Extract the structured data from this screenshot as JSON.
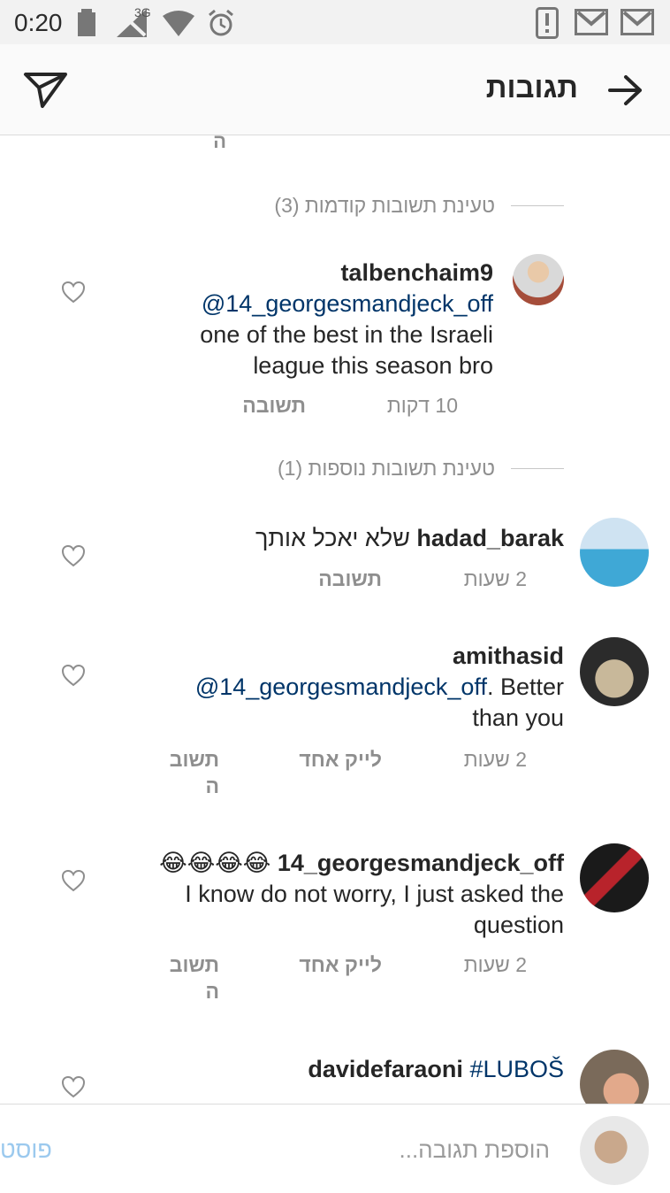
{
  "status_bar": {
    "time": "0:20",
    "network_label": "3G",
    "icons": [
      "battery-icon",
      "signal-icon",
      "wifi-icon",
      "alarm-icon",
      "alert-notification-icon",
      "gmail-icon",
      "gmail-icon"
    ]
  },
  "header": {
    "title": "תגובות",
    "back_icon": "arrow-right-icon",
    "share_icon": "send-icon"
  },
  "content": {
    "cut_text": "ה",
    "load_previous": "טעינת תשובות קודמות (3)",
    "load_more": "טעינת תשובות נוספות (1)",
    "comments": [
      {
        "username": "talbenchaim9",
        "mention": "@14_georgesmandjeck_off",
        "text_line1": "one of the best in the Israeli",
        "text_line2": "league this season bro",
        "time": "10 דקות",
        "reply": "תשובה"
      },
      {
        "username": "hadad_barak",
        "text": "שלא יאכל אותך",
        "time": "2 שעות",
        "reply": "תשובה"
      },
      {
        "username": "amithasid",
        "mention": "@14_georgesmandjeck_off",
        "text_inline": ". Better",
        "text_line2": "than you",
        "time": "2 שעות",
        "likes": "לייק אחד",
        "reply_line1": "תשוב",
        "reply_line2": "ה"
      },
      {
        "username": "14_georgesmandjeck_off",
        "emoji": "😂😂😂😂",
        "text_line1": "I know do not worry, I just asked the",
        "text_line2": "question",
        "time": "2 שעות",
        "likes": "לייק אחד",
        "reply_line1": "תשוב",
        "reply_line2": "ה"
      },
      {
        "username": "davidefaraoni",
        "hashtag": "#LUBOŠ"
      }
    ]
  },
  "composer": {
    "placeholder": "הוספת תגובה...",
    "post": "פוסט"
  },
  "colors": {
    "mention": "#003569",
    "secondary": "#8e8e8e",
    "post_disabled": "#9bc9ee"
  }
}
